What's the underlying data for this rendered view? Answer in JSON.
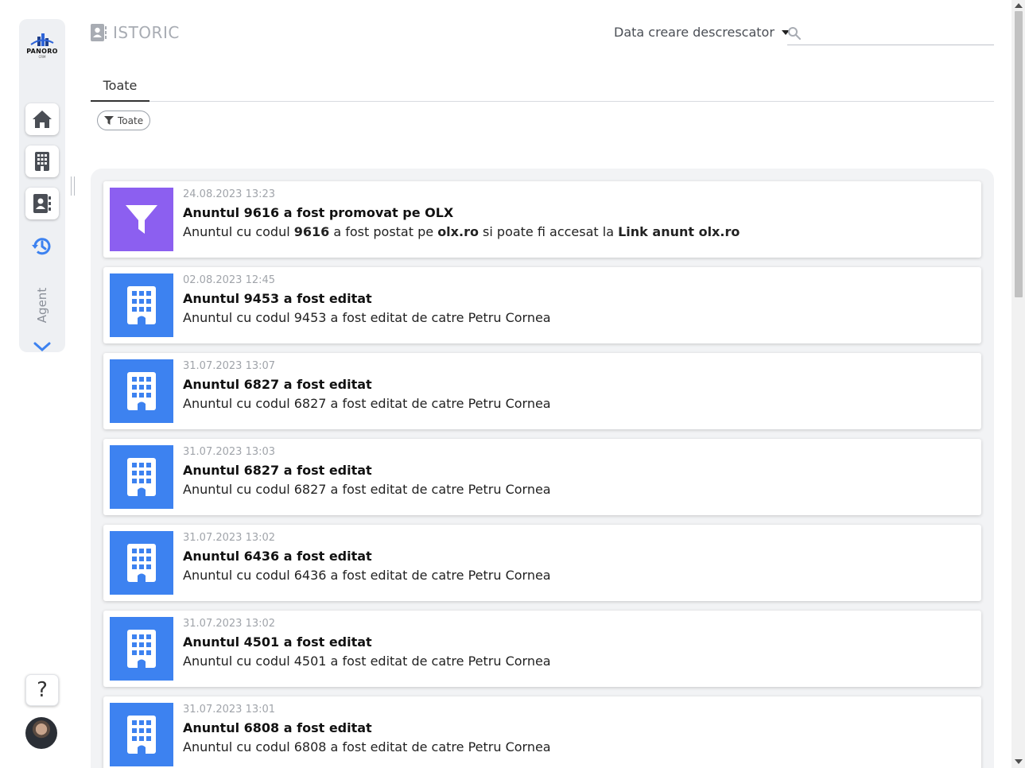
{
  "brand": {
    "name": "PANORO",
    "sub": "CRM"
  },
  "sidebar": {
    "agent_label": "Agent"
  },
  "help_label": "?",
  "header": {
    "title": "ISTORIC",
    "sort_label": "Data creare descrescator",
    "search_placeholder": ""
  },
  "tabs": [
    {
      "label": "Toate"
    }
  ],
  "filter_chip": {
    "label": "Toate"
  },
  "colors": {
    "accent_blue": "#3d82f0",
    "accent_purple": "#8c5ff0",
    "sidebar_bg": "#eef0f3"
  },
  "feed": [
    {
      "icon": "filter-icon",
      "date": "24.08.2023 13:23",
      "title": "Anuntul 9616 a fost promovat pe OLX",
      "desc_parts": [
        {
          "text": "Anuntul cu codul ",
          "bold": false
        },
        {
          "text": "9616",
          "bold": true
        },
        {
          "text": " a fost postat pe ",
          "bold": false
        },
        {
          "text": "olx.ro",
          "bold": true
        },
        {
          "text": " si poate fi accesat la ",
          "bold": false
        },
        {
          "text": "Link anunt olx.ro",
          "bold": true
        }
      ]
    },
    {
      "icon": "building-icon",
      "date": "02.08.2023 12:45",
      "title": "Anuntul 9453 a fost editat",
      "desc_parts": [
        {
          "text": "Anuntul cu codul 9453 a fost editat de catre Petru Cornea",
          "bold": false
        }
      ]
    },
    {
      "icon": "building-icon",
      "date": "31.07.2023 13:07",
      "title": "Anuntul 6827 a fost editat",
      "desc_parts": [
        {
          "text": "Anuntul cu codul 6827 a fost editat de catre Petru Cornea",
          "bold": false
        }
      ]
    },
    {
      "icon": "building-icon",
      "date": "31.07.2023 13:03",
      "title": "Anuntul 6827 a fost editat",
      "desc_parts": [
        {
          "text": "Anuntul cu codul 6827 a fost editat de catre Petru Cornea",
          "bold": false
        }
      ]
    },
    {
      "icon": "building-icon",
      "date": "31.07.2023 13:02",
      "title": "Anuntul 6436 a fost editat",
      "desc_parts": [
        {
          "text": "Anuntul cu codul 6436 a fost editat de catre Petru Cornea",
          "bold": false
        }
      ]
    },
    {
      "icon": "building-icon",
      "date": "31.07.2023 13:02",
      "title": "Anuntul 4501 a fost editat",
      "desc_parts": [
        {
          "text": "Anuntul cu codul 4501 a fost editat de catre Petru Cornea",
          "bold": false
        }
      ]
    },
    {
      "icon": "building-icon",
      "date": "31.07.2023 13:01",
      "title": "Anuntul 6808 a fost editat",
      "desc_parts": [
        {
          "text": "Anuntul cu codul 6808 a fost editat de catre Petru Cornea",
          "bold": false
        }
      ]
    }
  ]
}
